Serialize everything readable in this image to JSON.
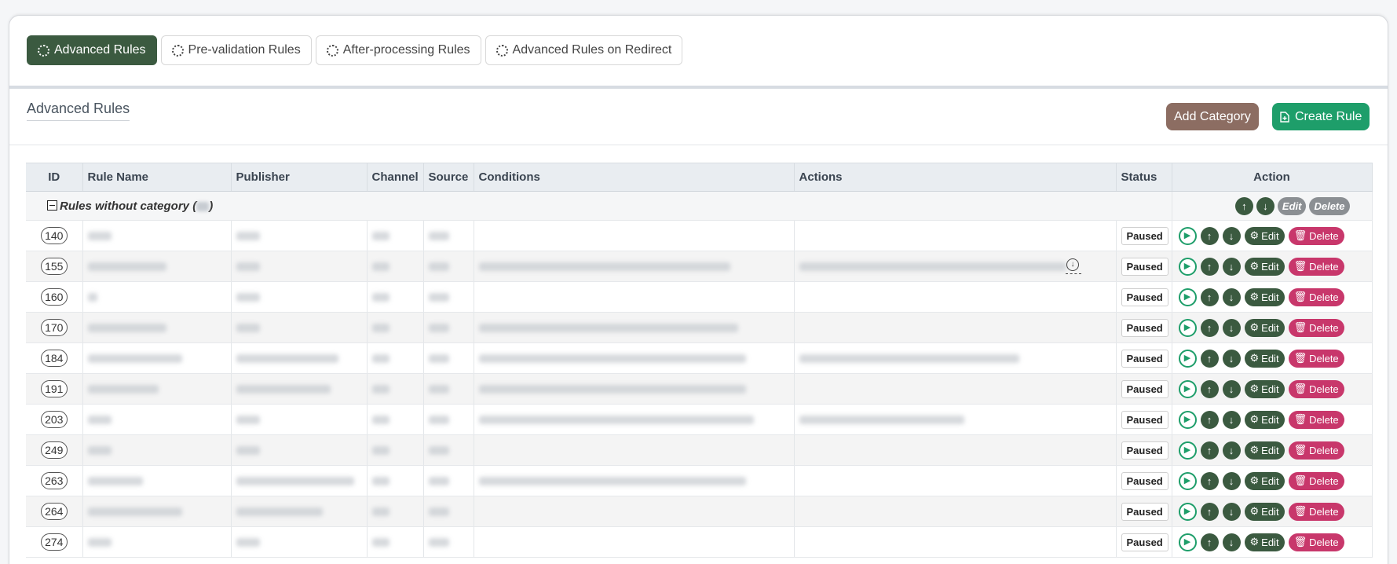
{
  "tabs": [
    {
      "label": "Advanced Rules",
      "active": true
    },
    {
      "label": "Pre-validation Rules",
      "active": false
    },
    {
      "label": "After-processing Rules",
      "active": false
    },
    {
      "label": "Advanced Rules on Redirect",
      "active": false
    }
  ],
  "section": {
    "title": "Advanced Rules",
    "add_category_label": "Add Category",
    "create_rule_label": "Create Rule"
  },
  "table": {
    "columns": [
      "ID",
      "Rule Name",
      "Publisher",
      "Channel",
      "Source",
      "Conditions",
      "Actions",
      "Status",
      "Action"
    ],
    "category": {
      "label": "Rules without category (",
      "label_end": ")",
      "edit_label": "Edit",
      "delete_label": "Delete"
    },
    "row_actions": {
      "edit_label": "Edit",
      "delete_label": "Delete"
    },
    "rows": [
      {
        "id": "140",
        "status": "Paused"
      },
      {
        "id": "155",
        "status": "Paused"
      },
      {
        "id": "160",
        "status": "Paused"
      },
      {
        "id": "170",
        "status": "Paused"
      },
      {
        "id": "184",
        "status": "Paused"
      },
      {
        "id": "191",
        "status": "Paused"
      },
      {
        "id": "203",
        "status": "Paused"
      },
      {
        "id": "249",
        "status": "Paused"
      },
      {
        "id": "263",
        "status": "Paused"
      },
      {
        "id": "264",
        "status": "Paused"
      },
      {
        "id": "274",
        "status": "Paused"
      }
    ]
  },
  "colors": {
    "accent_green_dark": "#3b5a40",
    "accent_green": "#1e9e6a",
    "brown": "#8c6d62",
    "delete_pink": "#c8376b"
  },
  "icons": [
    "ring-icon",
    "file-plus-icon",
    "minus-square-icon",
    "play-icon",
    "arrow-up-icon",
    "arrow-down-icon",
    "gear-icon",
    "trash-icon",
    "download-icon"
  ]
}
